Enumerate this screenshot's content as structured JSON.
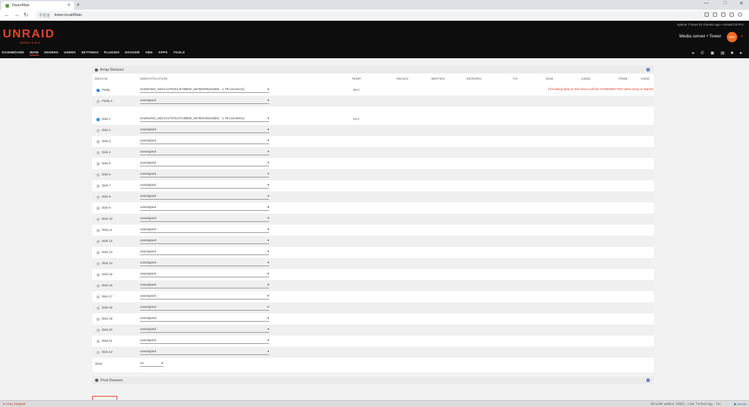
{
  "browser": {
    "tab_title": "Tower/Main",
    "security_label": "不安全",
    "url": "tower.local/Main"
  },
  "header": {
    "logo": "UNRAID",
    "version": "Version: 6.11.5",
    "uptime": "Uptime 7 hours 51 minutes ago   •   Unraid OS Pro",
    "server": "Media server  •  Tower",
    "accent_color": "#e2442c"
  },
  "nav": [
    "DASHBOARD",
    "MAIN",
    "SHARES",
    "USERS",
    "SETTINGS",
    "PLUGINS",
    "DOCKER",
    "VMS",
    "APPS",
    "TOOLS"
  ],
  "array": {
    "title": "Array Devices",
    "columns": [
      "DEVICE",
      "IDENTIFICATION",
      "TEMP.",
      "READS",
      "WRITES",
      "ERRORS",
      "FS",
      "SIZE",
      "USED",
      "FREE",
      "VIEW"
    ],
    "warning": "All existing data on this device will be OVERWRITTEN when array is Started",
    "rows": [
      {
        "device": "Parity",
        "id": "SAMSUNG_MZVL21T0HCLR-00B00_S676NX0N234582 - 1 TB (nvme1n1)",
        "temp": "28 C",
        "status": "blue"
      },
      {
        "device": "Parity 2",
        "id": "unassigned",
        "temp": "",
        "status": "gray"
      },
      {
        "device": "Disk 1",
        "id": "SAMSUNG_MZVL21T0HCLR-00B00_S676NX0N234581 - 1 TB (nvme0n1)",
        "temp": "24 C",
        "status": "blue"
      },
      {
        "device": "Disk 2",
        "id": "unassigned",
        "temp": "",
        "status": "gray"
      },
      {
        "device": "Disk 3",
        "id": "unassigned",
        "temp": "",
        "status": "gray"
      },
      {
        "device": "Disk 4",
        "id": "unassigned",
        "temp": "",
        "status": "gray"
      },
      {
        "device": "Disk 5",
        "id": "unassigned",
        "temp": "",
        "status": "gray"
      },
      {
        "device": "Disk 6",
        "id": "unassigned",
        "temp": "",
        "status": "gray"
      },
      {
        "device": "Disk 7",
        "id": "unassigned",
        "temp": "",
        "status": "gray"
      },
      {
        "device": "Disk 8",
        "id": "unassigned",
        "temp": "",
        "status": "gray"
      },
      {
        "device": "Disk 9",
        "id": "unassigned",
        "temp": "",
        "status": "gray"
      },
      {
        "device": "Disk 10",
        "id": "unassigned",
        "temp": "",
        "status": "gray"
      },
      {
        "device": "Disk 11",
        "id": "unassigned",
        "temp": "",
        "status": "gray"
      },
      {
        "device": "Disk 12",
        "id": "unassigned",
        "temp": "",
        "status": "gray"
      },
      {
        "device": "Disk 13",
        "id": "unassigned",
        "temp": "",
        "status": "gray"
      },
      {
        "device": "Disk 14",
        "id": "unassigned",
        "temp": "",
        "status": "gray"
      },
      {
        "device": "Disk 15",
        "id": "unassigned",
        "temp": "",
        "status": "gray"
      },
      {
        "device": "Disk 16",
        "id": "unassigned",
        "temp": "",
        "status": "gray"
      },
      {
        "device": "Disk 17",
        "id": "unassigned",
        "temp": "",
        "status": "gray"
      },
      {
        "device": "Disk 18",
        "id": "unassigned",
        "temp": "",
        "status": "gray"
      },
      {
        "device": "Disk 19",
        "id": "unassigned",
        "temp": "",
        "status": "gray"
      },
      {
        "device": "Disk 20",
        "id": "unassigned",
        "temp": "",
        "status": "gray"
      },
      {
        "device": "Disk 21",
        "id": "unassigned",
        "temp": "",
        "status": "gray"
      },
      {
        "device": "Disk 22",
        "id": "unassigned",
        "temp": "",
        "status": "gray"
      }
    ],
    "slots_label": "Slots:",
    "slots_value": "24"
  },
  "pool": {
    "title": "Pool Devices"
  },
  "status": {
    "left": "Array Stopped",
    "right": "Unraid® webGui ©2022, Lime Technology, Inc.",
    "manual": "manual"
  }
}
